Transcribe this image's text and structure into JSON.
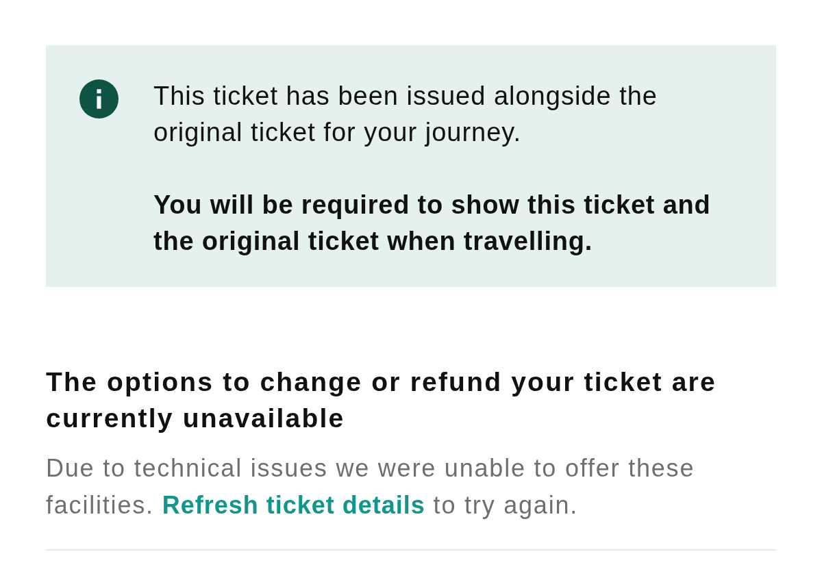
{
  "info_banner": {
    "message": "This ticket has been issued alongside the original ticket for your journey.",
    "emphasis": "You will be required to show this ticket and the original ticket when travelling."
  },
  "section": {
    "heading": "The options to change or refund your ticket are currently unavailable",
    "body_before": "Due to technical issues we were unable to offer these facilities.",
    "link": "Refresh ticket details",
    "body_after": "to try again."
  }
}
